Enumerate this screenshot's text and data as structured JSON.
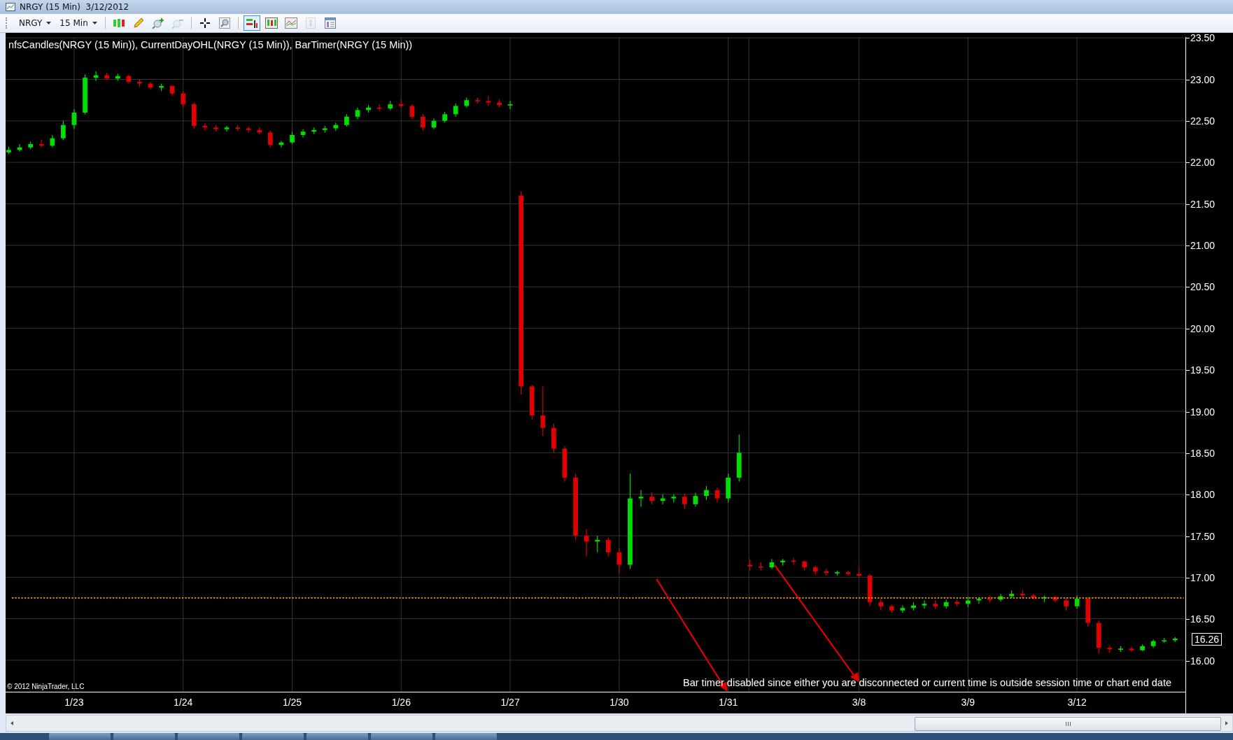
{
  "window": {
    "title": "NRGY (15 Min)  3/12/2012"
  },
  "toolbar": {
    "instrument": "NRGY",
    "interval": "15 Min",
    "tools": [
      {
        "kind": "candles",
        "selected": false,
        "disabled": false
      },
      {
        "kind": "pencil",
        "selected": false,
        "disabled": false
      },
      {
        "kind": "zoom-in",
        "selected": false,
        "disabled": false
      },
      {
        "kind": "zoom-out",
        "selected": false,
        "disabled": true
      },
      {
        "kind": "crosshair",
        "selected": false,
        "disabled": false
      },
      {
        "kind": "magnifier",
        "selected": false,
        "disabled": false
      },
      {
        "kind": "indicators",
        "selected": true,
        "disabled": false
      },
      {
        "kind": "strategies",
        "selected": false,
        "disabled": false
      },
      {
        "kind": "line-chart",
        "selected": false,
        "disabled": false
      },
      {
        "kind": "dollar",
        "selected": false,
        "disabled": true
      },
      {
        "kind": "properties",
        "selected": false,
        "disabled": false
      }
    ]
  },
  "chart": {
    "legend": "nfsCandles(NRGY (15 Min)), CurrentDayOHL(NRGY (15 Min)), BarTimer(NRGY (15 Min))",
    "last_price": "16.26",
    "message": "Bar timer disabled since either you are disconnected or current time is outside session time or chart end date",
    "copyright": "© 2012 NinjaTrader, LLC",
    "chart_data": {
      "type": "candlestick",
      "categories": [
        null,
        null,
        null,
        null,
        null,
        null,
        "1/23",
        null,
        null,
        null,
        null,
        null,
        null,
        null,
        null,
        null,
        "1/24",
        null,
        null,
        null,
        null,
        null,
        null,
        null,
        null,
        null,
        "1/25",
        null,
        null,
        null,
        null,
        null,
        null,
        null,
        null,
        null,
        "1/26",
        null,
        null,
        null,
        null,
        null,
        null,
        null,
        null,
        null,
        "1/27",
        null,
        null,
        null,
        null,
        null,
        null,
        null,
        null,
        null,
        "1/30",
        null,
        null,
        null,
        null,
        null,
        null,
        null,
        null,
        null,
        "1/31",
        null,
        null,
        null,
        null,
        null,
        null,
        null,
        null,
        null,
        null,
        null,
        "3/8",
        null,
        null,
        null,
        null,
        null,
        null,
        null,
        null,
        null,
        "3/9",
        null,
        null,
        null,
        null,
        null,
        null,
        null,
        null,
        null,
        "3/12",
        null,
        null,
        null,
        null,
        null,
        null,
        null,
        null,
        null
      ],
      "ohlc": [
        [
          22.12,
          22.19,
          22.1,
          22.15
        ],
        [
          22.15,
          22.22,
          22.13,
          22.18
        ],
        [
          22.18,
          22.25,
          22.16,
          22.22
        ],
        [
          22.22,
          22.27,
          22.18,
          22.2
        ],
        [
          22.2,
          22.33,
          22.18,
          22.29
        ],
        [
          22.29,
          22.5,
          22.27,
          22.45
        ],
        [
          22.45,
          22.64,
          22.4,
          22.6
        ],
        [
          22.6,
          23.06,
          22.58,
          23.02
        ],
        [
          23.02,
          23.1,
          22.98,
          23.05
        ],
        [
          23.05,
          23.08,
          22.99,
          23.01
        ],
        [
          23.01,
          23.07,
          22.98,
          23.04
        ],
        [
          23.04,
          23.06,
          22.95,
          22.97
        ],
        [
          22.97,
          23.0,
          22.91,
          22.95
        ],
        [
          22.95,
          22.97,
          22.88,
          22.9
        ],
        [
          22.9,
          22.95,
          22.86,
          22.92
        ],
        [
          22.92,
          22.93,
          22.8,
          22.83
        ],
        [
          22.83,
          22.86,
          22.66,
          22.7
        ],
        [
          22.7,
          22.72,
          22.4,
          22.44
        ],
        [
          22.44,
          22.48,
          22.38,
          22.42
        ],
        [
          22.42,
          22.45,
          22.37,
          22.4
        ],
        [
          22.4,
          22.44,
          22.37,
          22.42
        ],
        [
          22.42,
          22.45,
          22.38,
          22.41
        ],
        [
          22.41,
          22.43,
          22.36,
          22.39
        ],
        [
          22.39,
          22.42,
          22.34,
          22.36
        ],
        [
          22.36,
          22.38,
          22.18,
          22.21
        ],
        [
          22.21,
          22.26,
          22.18,
          22.24
        ],
        [
          22.24,
          22.37,
          22.22,
          22.33
        ],
        [
          22.33,
          22.4,
          22.3,
          22.37
        ],
        [
          22.37,
          22.42,
          22.34,
          22.39
        ],
        [
          22.39,
          22.44,
          22.36,
          22.41
        ],
        [
          22.41,
          22.48,
          22.38,
          22.45
        ],
        [
          22.45,
          22.58,
          22.43,
          22.55
        ],
        [
          22.55,
          22.66,
          22.52,
          22.63
        ],
        [
          22.63,
          22.69,
          22.6,
          22.66
        ],
        [
          22.66,
          22.7,
          22.62,
          22.65
        ],
        [
          22.65,
          22.74,
          22.63,
          22.7
        ],
        [
          22.7,
          22.76,
          22.66,
          22.68
        ],
        [
          22.68,
          22.7,
          22.52,
          22.55
        ],
        [
          22.55,
          22.58,
          22.38,
          22.42
        ],
        [
          22.42,
          22.53,
          22.4,
          22.5
        ],
        [
          22.5,
          22.61,
          22.48,
          22.58
        ],
        [
          22.58,
          22.71,
          22.55,
          22.68
        ],
        [
          22.68,
          22.78,
          22.66,
          22.75
        ],
        [
          22.75,
          22.78,
          22.71,
          22.74
        ],
        [
          22.74,
          22.8,
          22.68,
          22.72
        ],
        [
          22.72,
          22.76,
          22.66,
          22.69
        ],
        [
          22.69,
          22.74,
          22.64,
          22.7
        ],
        [
          21.6,
          21.65,
          19.2,
          19.3
        ],
        [
          19.3,
          19.32,
          18.9,
          18.95
        ],
        [
          18.95,
          19.3,
          18.7,
          18.8
        ],
        [
          18.8,
          18.85,
          18.5,
          18.55
        ],
        [
          18.55,
          18.58,
          18.15,
          18.2
        ],
        [
          18.2,
          18.25,
          17.45,
          17.5
        ],
        [
          17.5,
          17.58,
          17.25,
          17.43
        ],
        [
          17.43,
          17.5,
          17.3,
          17.45
        ],
        [
          17.45,
          17.48,
          17.25,
          17.3
        ],
        [
          17.3,
          17.35,
          17.05,
          17.15
        ],
        [
          17.15,
          18.25,
          17.1,
          17.95
        ],
        [
          17.95,
          18.05,
          17.85,
          17.97
        ],
        [
          17.97,
          18.02,
          17.88,
          17.92
        ],
        [
          17.92,
          18.0,
          17.88,
          17.95
        ],
        [
          17.95,
          18.0,
          17.9,
          17.97
        ],
        [
          17.97,
          18.01,
          17.82,
          17.88
        ],
        [
          17.88,
          18.02,
          17.85,
          17.98
        ],
        [
          17.98,
          18.1,
          17.93,
          18.05
        ],
        [
          18.05,
          18.08,
          17.9,
          17.95
        ],
        [
          17.95,
          18.25,
          17.9,
          18.2
        ],
        [
          18.2,
          18.72,
          18.15,
          18.5
        ],
        [
          17.15,
          17.22,
          17.08,
          17.13
        ],
        [
          17.13,
          17.18,
          17.08,
          17.12
        ],
        [
          17.12,
          17.22,
          17.1,
          17.18
        ],
        [
          17.18,
          17.22,
          17.14,
          17.2
        ],
        [
          17.2,
          17.23,
          17.15,
          17.19
        ],
        [
          17.19,
          17.2,
          17.08,
          17.12
        ],
        [
          17.12,
          17.14,
          17.03,
          17.07
        ],
        [
          17.07,
          17.1,
          17.02,
          17.05
        ],
        [
          17.05,
          17.08,
          17.02,
          17.06
        ],
        [
          17.06,
          17.08,
          17.02,
          17.04
        ],
        [
          17.04,
          17.12,
          17.0,
          17.02
        ],
        [
          17.02,
          17.04,
          16.65,
          16.7
        ],
        [
          16.7,
          16.74,
          16.6,
          16.65
        ],
        [
          16.65,
          16.67,
          16.57,
          16.6
        ],
        [
          16.6,
          16.66,
          16.57,
          16.63
        ],
        [
          16.63,
          16.7,
          16.6,
          16.66
        ],
        [
          16.66,
          16.72,
          16.62,
          16.68
        ],
        [
          16.68,
          16.72,
          16.62,
          16.65
        ],
        [
          16.65,
          16.73,
          16.62,
          16.7
        ],
        [
          16.7,
          16.73,
          16.65,
          16.68
        ],
        [
          16.68,
          16.76,
          16.64,
          16.72
        ],
        [
          16.72,
          16.76,
          16.68,
          16.74
        ],
        [
          16.74,
          16.78,
          16.7,
          16.73
        ],
        [
          16.73,
          16.8,
          16.71,
          16.77
        ],
        [
          16.77,
          16.84,
          16.75,
          16.8
        ],
        [
          16.8,
          16.85,
          16.76,
          16.78
        ],
        [
          16.78,
          16.8,
          16.73,
          16.75
        ],
        [
          16.75,
          16.78,
          16.7,
          16.76
        ],
        [
          16.76,
          16.78,
          16.7,
          16.72
        ],
        [
          16.72,
          16.75,
          16.6,
          16.65
        ],
        [
          16.65,
          16.78,
          16.62,
          16.74
        ],
        [
          16.74,
          16.76,
          16.4,
          16.45
        ],
        [
          16.45,
          16.48,
          16.08,
          16.15
        ],
        [
          16.15,
          16.18,
          16.09,
          16.13
        ],
        [
          16.13,
          16.17,
          16.1,
          16.14
        ],
        [
          16.14,
          16.16,
          16.1,
          16.12
        ],
        [
          16.12,
          16.19,
          16.11,
          16.17
        ],
        [
          16.17,
          16.25,
          16.15,
          16.23
        ],
        [
          16.23,
          16.27,
          16.21,
          16.24
        ],
        [
          16.24,
          16.28,
          16.22,
          16.26
        ]
      ],
      "ylim": [
        15.62,
        23.51
      ],
      "grid": true,
      "ref_lines": [
        {
          "axis": "y",
          "value": 16.75,
          "color": "#f0a000"
        }
      ],
      "yticks": [
        {
          "value": 23.5,
          "label": "23.50"
        },
        {
          "value": 23,
          "label": "23.00"
        },
        {
          "value": 22.5,
          "label": "22.50"
        },
        {
          "value": 22,
          "label": "22.00"
        },
        {
          "value": 21.5,
          "label": "21.50"
        },
        {
          "value": 21,
          "label": "21.00"
        },
        {
          "value": 20.5,
          "label": "20.50"
        },
        {
          "value": 20,
          "label": "20.00"
        },
        {
          "value": 19.5,
          "label": "19.50"
        },
        {
          "value": 19,
          "label": "19.00"
        },
        {
          "value": 18.5,
          "label": "18.50"
        },
        {
          "value": 18,
          "label": "18.00"
        },
        {
          "value": 17.5,
          "label": "17.50"
        },
        {
          "value": 17,
          "label": "17.00"
        },
        {
          "value": 16.5,
          "label": "16.50"
        },
        {
          "value": 16,
          "label": "16.00"
        }
      ]
    }
  }
}
